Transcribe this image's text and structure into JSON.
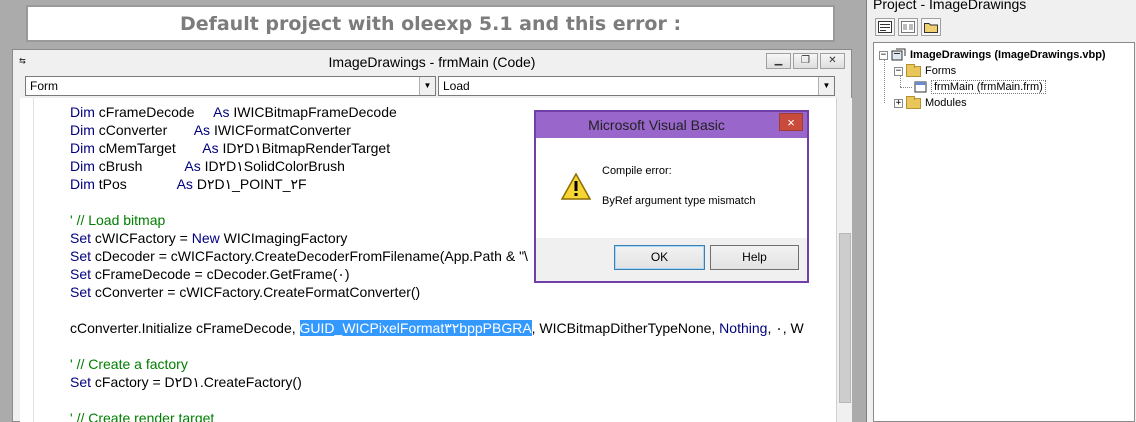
{
  "banner": {
    "text": "Default project with oleexp 5.1 and this error :"
  },
  "code_window": {
    "title": "ImageDrawings - frmMain (Code)",
    "object_combo": "Form",
    "proc_combo": "Load",
    "lines": [
      {
        "parts": [
          {
            "k": "kw",
            "t": "Dim"
          },
          {
            "k": "",
            "t": " cFrameDecode     "
          },
          {
            "k": "kw",
            "t": "As"
          },
          {
            "k": "",
            "t": " IWICBitmapFrameDecode"
          }
        ]
      },
      {
        "parts": [
          {
            "k": "kw",
            "t": "Dim"
          },
          {
            "k": "",
            "t": " cConverter       "
          },
          {
            "k": "kw",
            "t": "As"
          },
          {
            "k": "",
            "t": " IWICFormatConverter"
          }
        ]
      },
      {
        "parts": [
          {
            "k": "kw",
            "t": "Dim"
          },
          {
            "k": "",
            "t": " cMemTarget       "
          },
          {
            "k": "kw",
            "t": "As"
          },
          {
            "k": "",
            "t": " ID٢D١BitmapRenderTarget"
          }
        ]
      },
      {
        "parts": [
          {
            "k": "kw",
            "t": "Dim"
          },
          {
            "k": "",
            "t": " cBrush           "
          },
          {
            "k": "kw",
            "t": "As"
          },
          {
            "k": "",
            "t": " ID٢D١SolidColorBrush"
          }
        ]
      },
      {
        "parts": [
          {
            "k": "kw",
            "t": "Dim"
          },
          {
            "k": "",
            "t": " tPos             "
          },
          {
            "k": "kw",
            "t": "As"
          },
          {
            "k": "",
            "t": " D٢D١_POINT_٢F"
          }
        ]
      },
      {
        "parts": [
          {
            "k": "",
            "t": " "
          }
        ]
      },
      {
        "parts": [
          {
            "k": "cm",
            "t": "' // Load bitmap"
          }
        ]
      },
      {
        "parts": [
          {
            "k": "kw",
            "t": "Set"
          },
          {
            "k": "",
            "t": " cWICFactory = "
          },
          {
            "k": "kw",
            "t": "New"
          },
          {
            "k": "",
            "t": " WICImagingFactory"
          }
        ]
      },
      {
        "parts": [
          {
            "k": "kw",
            "t": "Set"
          },
          {
            "k": "",
            "t": " cDecoder = cWICFactory.CreateDecoderFromFilename(App.Path & \"\\"
          }
        ]
      },
      {
        "parts": [
          {
            "k": "kw",
            "t": "Set"
          },
          {
            "k": "",
            "t": " cFrameDecode = cDecoder.GetFrame(٠)"
          }
        ]
      },
      {
        "parts": [
          {
            "k": "kw",
            "t": "Set"
          },
          {
            "k": "",
            "t": " cConverter = cWICFactory.CreateFormatConverter()"
          }
        ]
      },
      {
        "parts": [
          {
            "k": "",
            "t": " "
          }
        ]
      },
      {
        "parts": [
          {
            "k": "",
            "t": "cConverter.Initialize cFrameDecode, "
          },
          {
            "k": "sel",
            "t": "GUID_WICPixelFormat٣٢bppPBGRA"
          },
          {
            "k": "",
            "t": ", WICBitmapDitherTypeNone, "
          },
          {
            "k": "kw",
            "t": "Nothing"
          },
          {
            "k": "",
            "t": ", ٠, W"
          }
        ]
      },
      {
        "parts": [
          {
            "k": "",
            "t": " "
          }
        ]
      },
      {
        "parts": [
          {
            "k": "cm",
            "t": "' // Create a factory"
          }
        ]
      },
      {
        "parts": [
          {
            "k": "kw",
            "t": "Set"
          },
          {
            "k": "",
            "t": " cFactory = D٢D١.CreateFactory()"
          }
        ]
      },
      {
        "parts": [
          {
            "k": "",
            "t": " "
          }
        ]
      },
      {
        "parts": [
          {
            "k": "cm",
            "t": "' // Create render target"
          }
        ]
      }
    ],
    "right_clip": ", W"
  },
  "dialog": {
    "title": "Microsoft Visual Basic",
    "close": "×",
    "message_line1": "Compile error:",
    "message_line2": "ByRef argument type mismatch",
    "ok_label": "OK",
    "help_label": "Help"
  },
  "project": {
    "title": "Project - ImageDrawings",
    "root": "ImageDrawings (ImageDrawings.vbp)",
    "forms_folder": "Forms",
    "form_item": "frmMain (frmMain.frm)",
    "modules_folder": "Modules"
  }
}
